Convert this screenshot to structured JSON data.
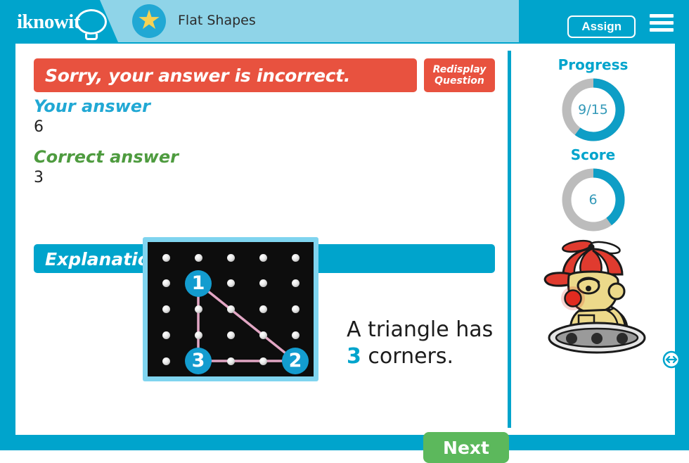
{
  "header": {
    "logo_text": "iknowit",
    "logo_icon": "lightbulb-icon",
    "star_icon": "star-icon",
    "lesson_title": "Flat Shapes",
    "assign_label": "Assign",
    "menu_icon": "hamburger-menu-icon"
  },
  "feedback": {
    "banner_text": "Sorry, your answer is incorrect.",
    "banner_color": "#e8523f",
    "redisplay_line1": "Redisplay",
    "redisplay_line2": "Question"
  },
  "answers": {
    "your_answer_label": "Your answer",
    "your_answer_value": "6",
    "your_answer_color": "#21a8d4",
    "correct_answer_label": "Correct answer",
    "correct_answer_value": "3",
    "correct_answer_color": "#4e9b3f"
  },
  "explanation": {
    "heading": "Explanation",
    "heading_color": "#00a4cc",
    "text_before": "A triangle has ",
    "highlight": "3",
    "text_after": " corners.",
    "highlight_color": "#00a4cc"
  },
  "geoboard": {
    "rows": 5,
    "cols": 5,
    "board_color": "#0d0d0d",
    "frame_color": "#7fd4ef",
    "band_color": "#e2a6c4",
    "vertices": [
      {
        "label": "1",
        "col": 2,
        "row": 2
      },
      {
        "label": "2",
        "col": 5,
        "row": 5
      },
      {
        "label": "3",
        "col": 2,
        "row": 5
      }
    ],
    "vertex_badge_color": "#139ccf"
  },
  "actions": {
    "next_label": "Next",
    "next_color": "#5cb85c"
  },
  "sidebar": {
    "progress": {
      "label": "Progress",
      "value": "9/15",
      "completed": 9,
      "total": 15,
      "percent": 60,
      "fill_color": "#0e9ec6",
      "track_color": "#bcbcbc"
    },
    "score": {
      "label": "Score",
      "value": "6",
      "percent": 40,
      "fill_color": "#0e9ec6",
      "track_color": "#bcbcbc"
    },
    "mascot_icon": "robot-mascot-icon",
    "resize_icon": "horizontal-resize-arrow-icon"
  }
}
